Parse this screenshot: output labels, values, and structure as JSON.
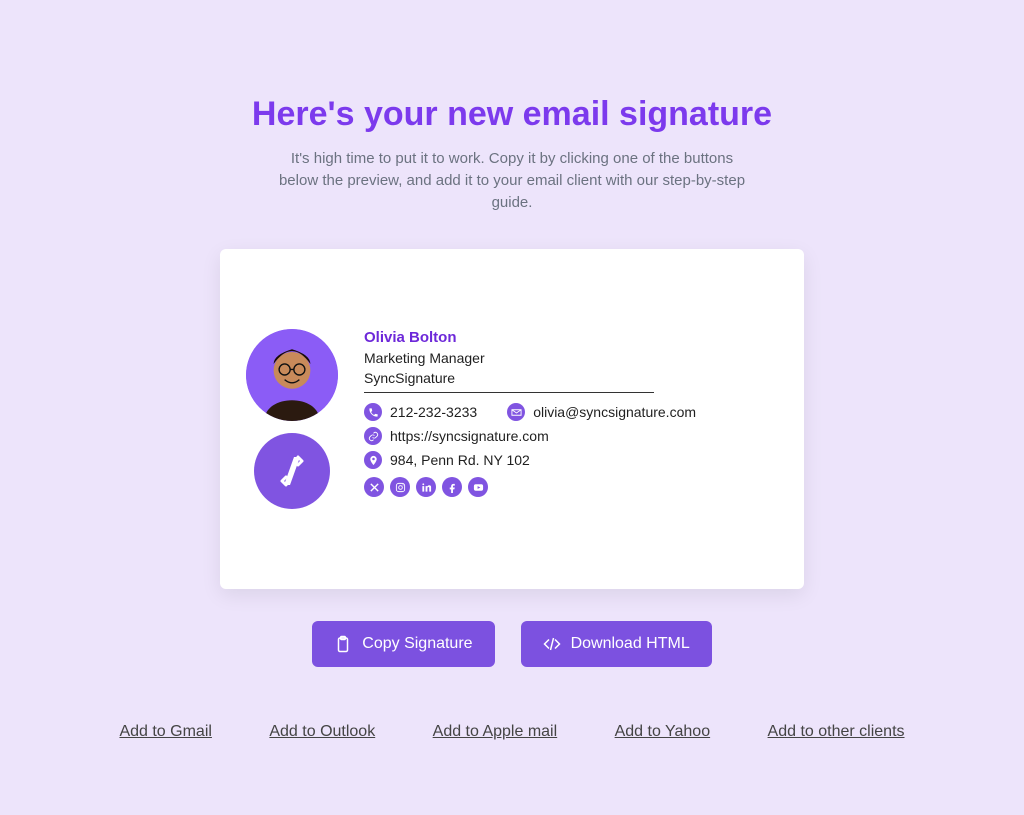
{
  "header": {
    "title": "Here's your new email signature",
    "subtitle": "It's high time to put it to work. Copy it by clicking one of the buttons below the preview, and add it to your email client with our step-by-step guide."
  },
  "signature": {
    "name": "Olivia Bolton",
    "role": "Marketing Manager",
    "company": "SyncSignature",
    "phone": "212-232-3233",
    "email": "olivia@syncsignature.com",
    "website": "https://syncsignature.com",
    "address": "984, Penn Rd. NY 102",
    "socials": [
      "x",
      "instagram",
      "linkedin",
      "facebook",
      "youtube"
    ]
  },
  "buttons": {
    "copy": "Copy Signature",
    "download": "Download HTML"
  },
  "links": {
    "gmail": "Add to Gmail",
    "outlook": "Add to Outlook",
    "apple": "Add to Apple mail",
    "yahoo": "Add to Yahoo",
    "other": "Add to other clients"
  }
}
